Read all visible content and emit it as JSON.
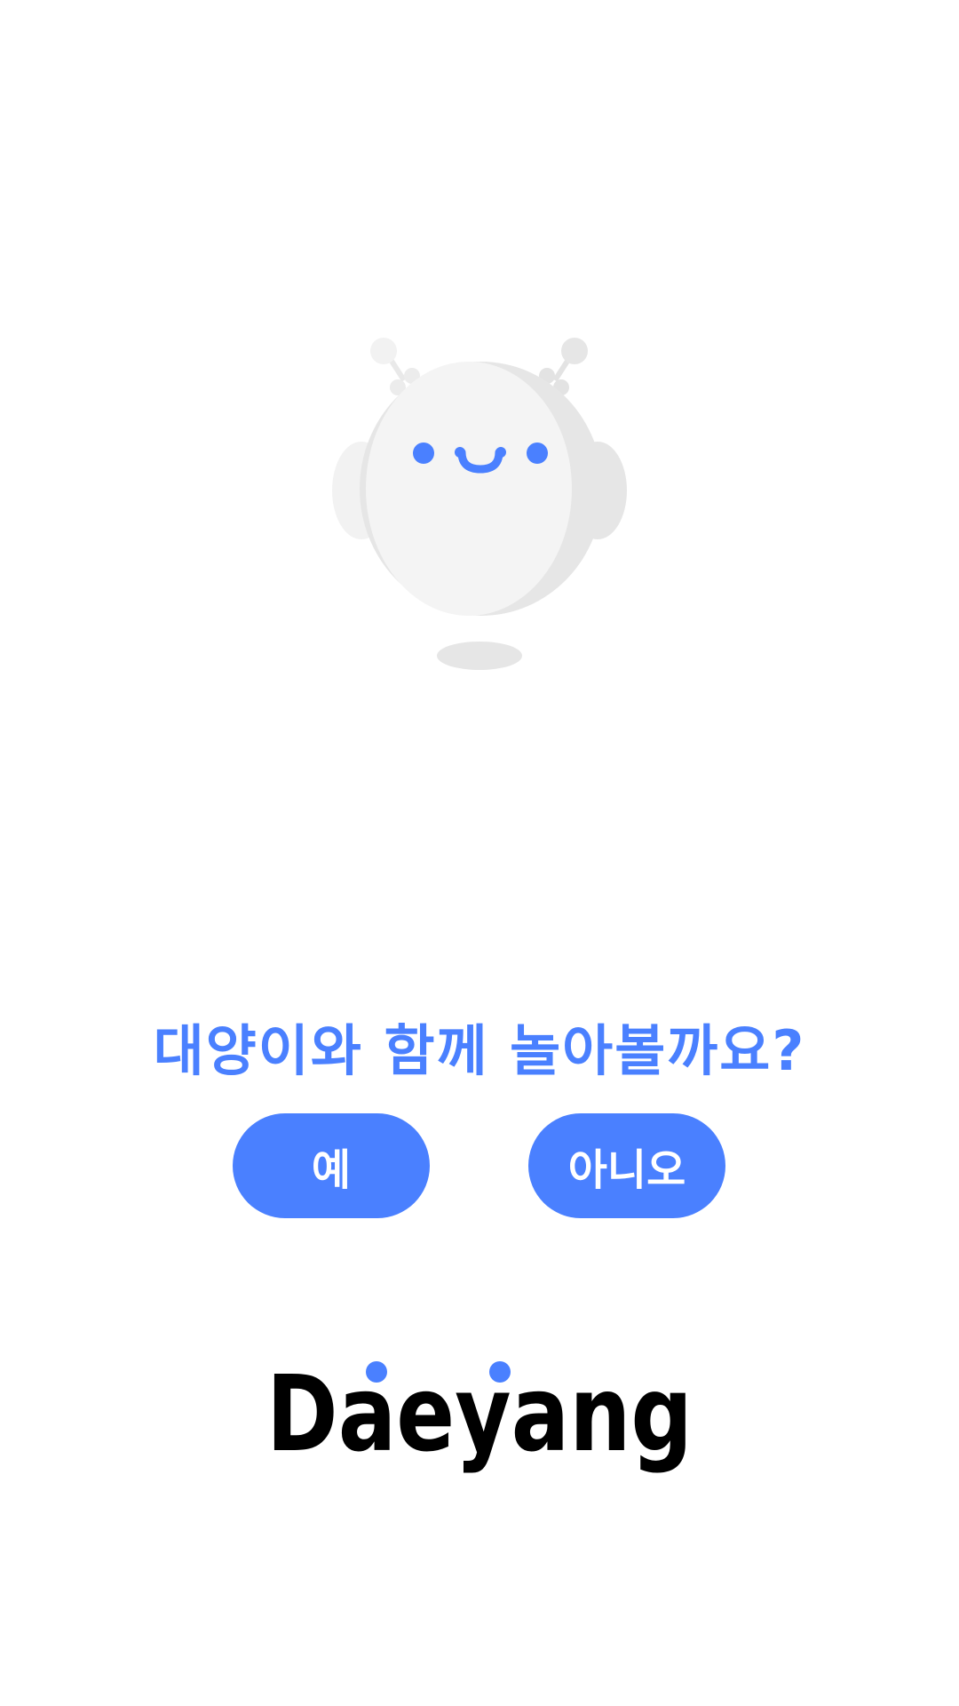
{
  "prompt": {
    "question": "대양이와 함께 놀아볼까요?"
  },
  "buttons": {
    "yes_label": "예",
    "no_label": "아니오"
  },
  "brand": {
    "logo_text": "Daeyang"
  },
  "colors": {
    "accent": "#4a80ff",
    "mascot_body": "#f4f4f4",
    "mascot_shade": "#e6e6e6",
    "logo": "#000000",
    "background": "#ffffff"
  },
  "icons": {
    "mascot": "robot-mascot-icon"
  }
}
